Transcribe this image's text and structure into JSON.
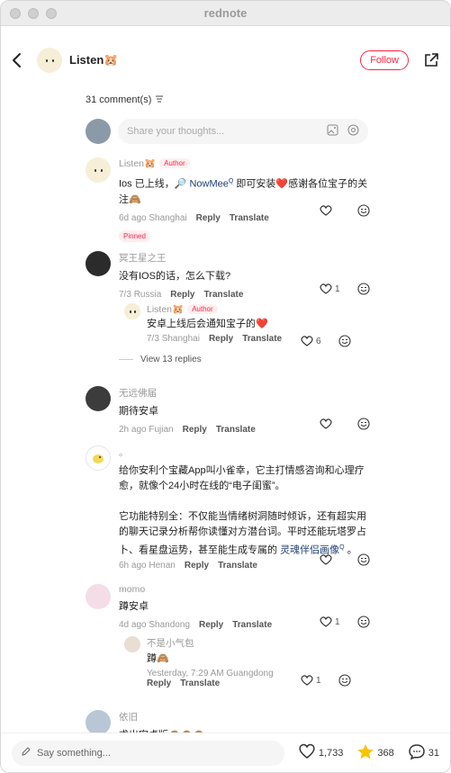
{
  "window": {
    "title": "rednote"
  },
  "header": {
    "author_name": "Listen🐹",
    "follow_label": "Follow"
  },
  "comments_header": {
    "count_label": "31 comment(s)"
  },
  "compose": {
    "placeholder": "Share your thoughts..."
  },
  "comments": [
    {
      "name": "Listen🐹",
      "tag": "Author",
      "text_a": "Ios 已上线，🔎 ",
      "text_link": "NowMee",
      "text_sup": "Q",
      "text_b": " 即可安装❤️感谢各位宝子的关注🙈",
      "time": "6d ago",
      "location": "Shanghai",
      "reply": "Reply",
      "translate": "Translate",
      "pinned": "Pinned"
    },
    {
      "name": "冥王星之王",
      "text": "没有IOS的话，怎么下载?",
      "time": "7/3",
      "location": "Russia",
      "reply": "Reply",
      "translate": "Translate",
      "likes": "1",
      "sub": {
        "name": "Listen🐹",
        "tag": "Author",
        "text": "安卓上线后会通知宝子的❤️",
        "time": "7/3",
        "location": "Shanghai",
        "reply": "Reply",
        "translate": "Translate",
        "likes": "6"
      },
      "view_more": "View 13 replies"
    },
    {
      "name": "无远佛届",
      "text": "期待安卓",
      "time": "2h ago",
      "location": "Fujian",
      "reply": "Reply",
      "translate": "Translate"
    },
    {
      "name": "。",
      "text1": "给你安利个宝藏App叫小雀幸，它主打情感咨询和心理疗愈，就像个24小时在线的“电子闺蜜”。",
      "text2_a": "它功能特别全：不仅能当情绪树洞随时倾诉，还有超实用的聊天记录分析帮你读懂对方潜台词。平时还能玩塔罗占卜、看星盘运势，甚至能生成专属的 ",
      "text2_link": "灵魂伴侣画像",
      "text2_sup": "Q",
      "text2_b": " 。",
      "time": "6h ago",
      "location": "Henan",
      "reply": "Reply",
      "translate": "Translate"
    },
    {
      "name": "momo",
      "text": "蹲安卓",
      "time": "4d ago",
      "location": "Shandong",
      "reply": "Reply",
      "translate": "Translate",
      "likes": "1",
      "sub": {
        "name": "不是小气包",
        "text": "蹲🙈",
        "time": "Yesterday, 7:29 AM",
        "location": "Guangdong",
        "reply": "Reply",
        "translate": "Translate",
        "likes": "1"
      }
    },
    {
      "name": "依旧",
      "text": "求出安卓版🙈🙈🙈"
    }
  ],
  "bottom": {
    "placeholder": "Say something...",
    "likes": "1,733",
    "collects": "368",
    "comments": "31"
  },
  "colors": {
    "accent": "#ff2442",
    "link": "#1e3f73",
    "collect": "#f7c400"
  }
}
